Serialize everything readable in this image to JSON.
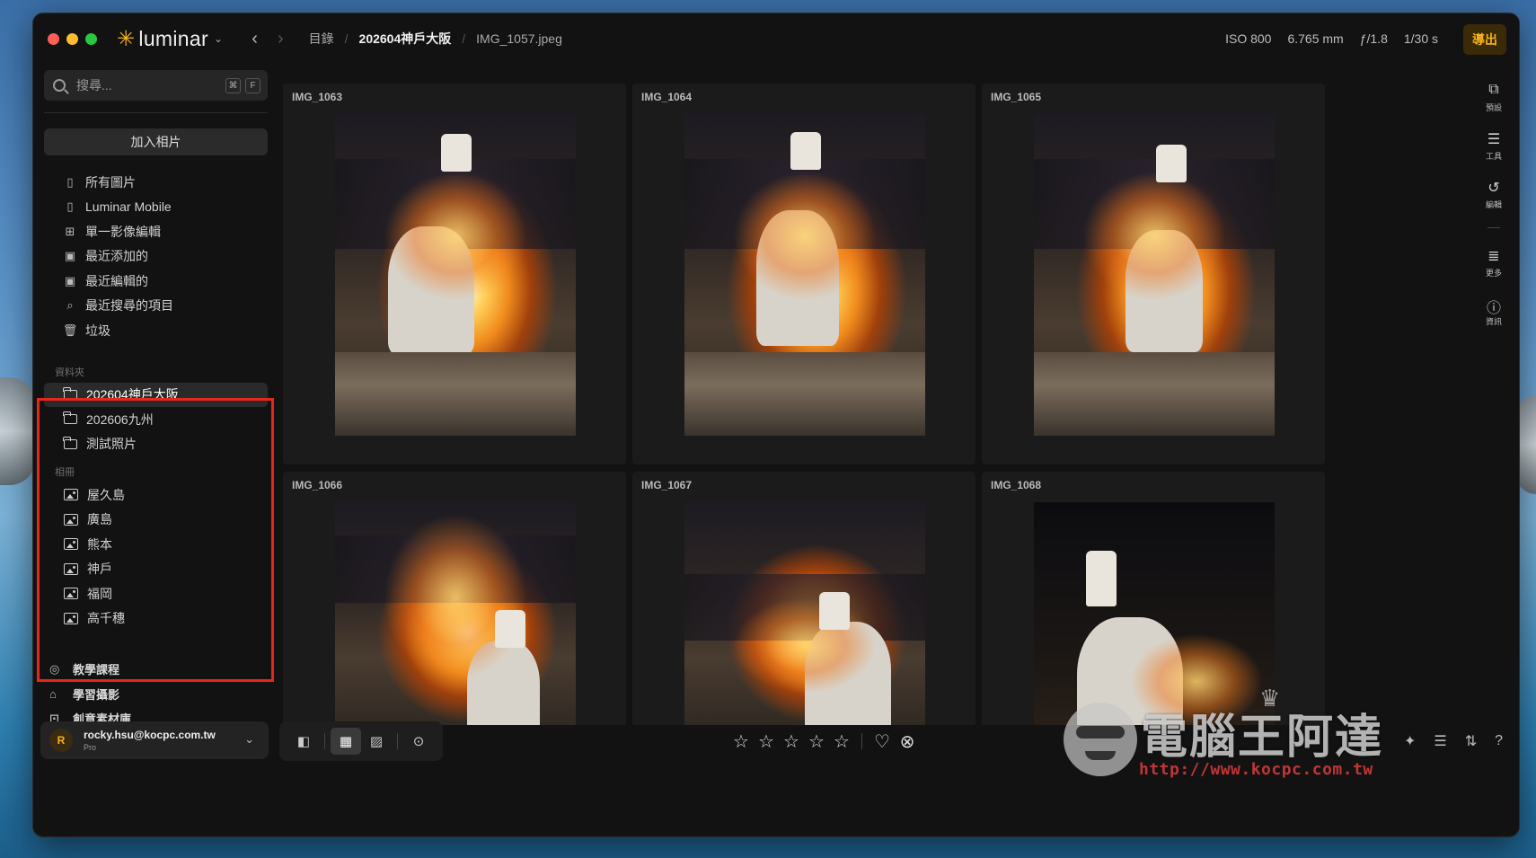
{
  "app": {
    "brand": "luminar",
    "breadcrumb": [
      "目錄",
      "202604神戶大阪",
      "IMG_1057.jpeg"
    ]
  },
  "exif": {
    "iso": "ISO 800",
    "focal": "6.765 mm",
    "aperture": "ƒ/1.8",
    "shutter": "1/30 s"
  },
  "toolbar": {
    "export_label": "導出"
  },
  "search": {
    "placeholder": "搜尋...",
    "kbd1": "⌘",
    "kbd2": "F"
  },
  "sidebar": {
    "add_photos": "加入相片",
    "nav": [
      {
        "label": "所有圖片",
        "icon": "photo-stack-icon"
      },
      {
        "label": "Luminar Mobile",
        "icon": "phone-icon"
      },
      {
        "label": "單一影像編輯",
        "icon": "grid-icon"
      },
      {
        "label": "最近添加的",
        "icon": "recent-added-icon"
      },
      {
        "label": "最近編輯的",
        "icon": "recent-edited-icon"
      },
      {
        "label": "最近搜尋的項目",
        "icon": "search-icon"
      },
      {
        "label": "垃圾",
        "icon": "trash-icon"
      }
    ],
    "folders_label": "資料夾",
    "folders": [
      "202604神戶大阪",
      "202606九州",
      "測試照片"
    ],
    "albums_label": "相冊",
    "albums": [
      "屋久島",
      "廣島",
      "熊本",
      "神戶",
      "福岡",
      "高千穗"
    ],
    "links": [
      "教學課程",
      "學習攝影",
      "創意素材庫"
    ]
  },
  "account": {
    "email": "rocky.hsu@kocpc.com.tw",
    "plan": "Pro",
    "initial": "R"
  },
  "photos": [
    "IMG_1063",
    "IMG_1064",
    "IMG_1065",
    "IMG_1066",
    "IMG_1067",
    "IMG_1068"
  ],
  "right_tools": [
    {
      "label": "預設",
      "icon": "presets-icon"
    },
    {
      "label": "工具",
      "icon": "sliders-icon"
    },
    {
      "label": "編輯",
      "icon": "history-icon"
    },
    {
      "label": "更多",
      "icon": "list-icon"
    },
    {
      "label": "資訊",
      "icon": "info-icon"
    }
  ],
  "rating": {
    "stars": 5
  },
  "watermark": {
    "text": "電腦王阿達",
    "url": "http://www.kocpc.com.tw"
  },
  "colors": {
    "accent": "#f6b21b",
    "highlight_box": "#e8261c"
  }
}
